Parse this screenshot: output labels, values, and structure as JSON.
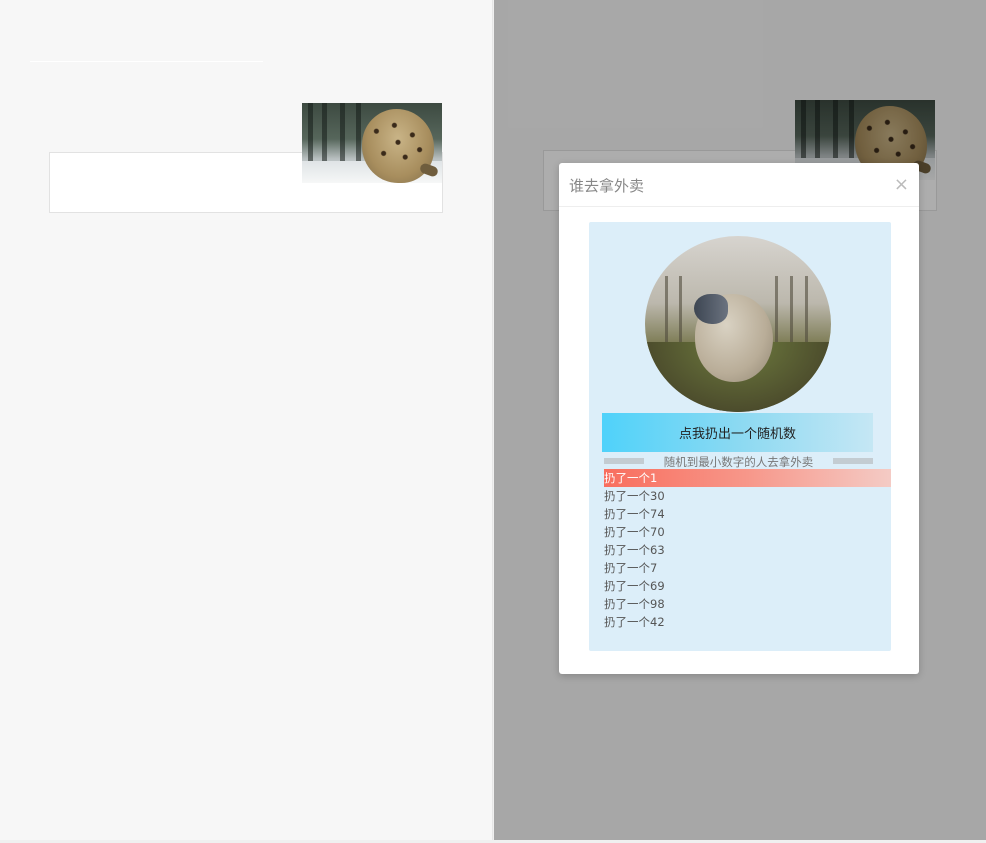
{
  "modal": {
    "title": "谁去拿外卖",
    "close_icon": "×",
    "button_label": "点我扔出一个随机数",
    "hint": "随机到最小数字的人去拿外卖",
    "results": [
      "扔了一个1",
      "扔了一个30",
      "扔了一个74",
      "扔了一个70",
      "扔了一个63",
      "扔了一个7",
      "扔了一个69",
      "扔了一个98",
      "扔了一个42"
    ]
  },
  "images": {
    "left_thumbnail": "leopard-image",
    "right_thumbnail": "leopard-image",
    "avatar": "sheep-image"
  },
  "colors": {
    "modal_body_bg": "#dceef9",
    "button_gradient_start": "#4fd2fa",
    "highlight_gradient_start": "#f86e5e",
    "overlay": "rgba(0,0,0,0.32)"
  }
}
